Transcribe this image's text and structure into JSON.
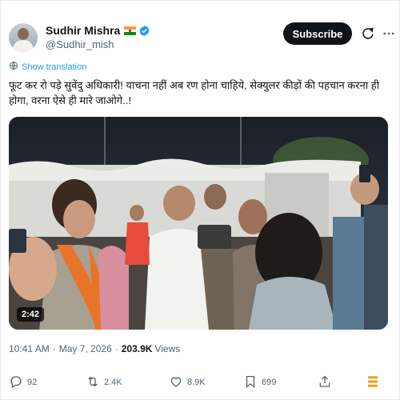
{
  "author": {
    "name": "Sudhir Mishra",
    "handle": "@Sudhir_mish",
    "verified": true,
    "flag_icon": "india-flag-icon",
    "flag_colors": [
      "#ff9933",
      "#ffffff",
      "#138808"
    ]
  },
  "header": {
    "subscribe_label": "Subscribe",
    "grok_icon": "grok-icon",
    "more_icon": "more-options-icon"
  },
  "translate_label": "Show translation",
  "tweet_text": "फूट कर रो पड़े सुवेंदु अधिकारी! याचना नहीं अब रण होना चाहिये, सेक्युलर कीड़ों की पहचान करना ही होगा, वरना ऐसे ही मारे जाओगे..!",
  "media": {
    "type": "video",
    "duration": "2:42"
  },
  "meta": {
    "time": "10:41 AM",
    "date": "May 7, 2026",
    "views_count": "203.9K",
    "views_label": "Views"
  },
  "actions": {
    "replies": "92",
    "reposts": "2.4K",
    "likes": "8.9K",
    "bookmarks": "699"
  },
  "colors": {
    "accent": "#1d9bf0",
    "text": "#0f1419",
    "secondary": "#536471",
    "grok_orange": "#e8a317"
  }
}
